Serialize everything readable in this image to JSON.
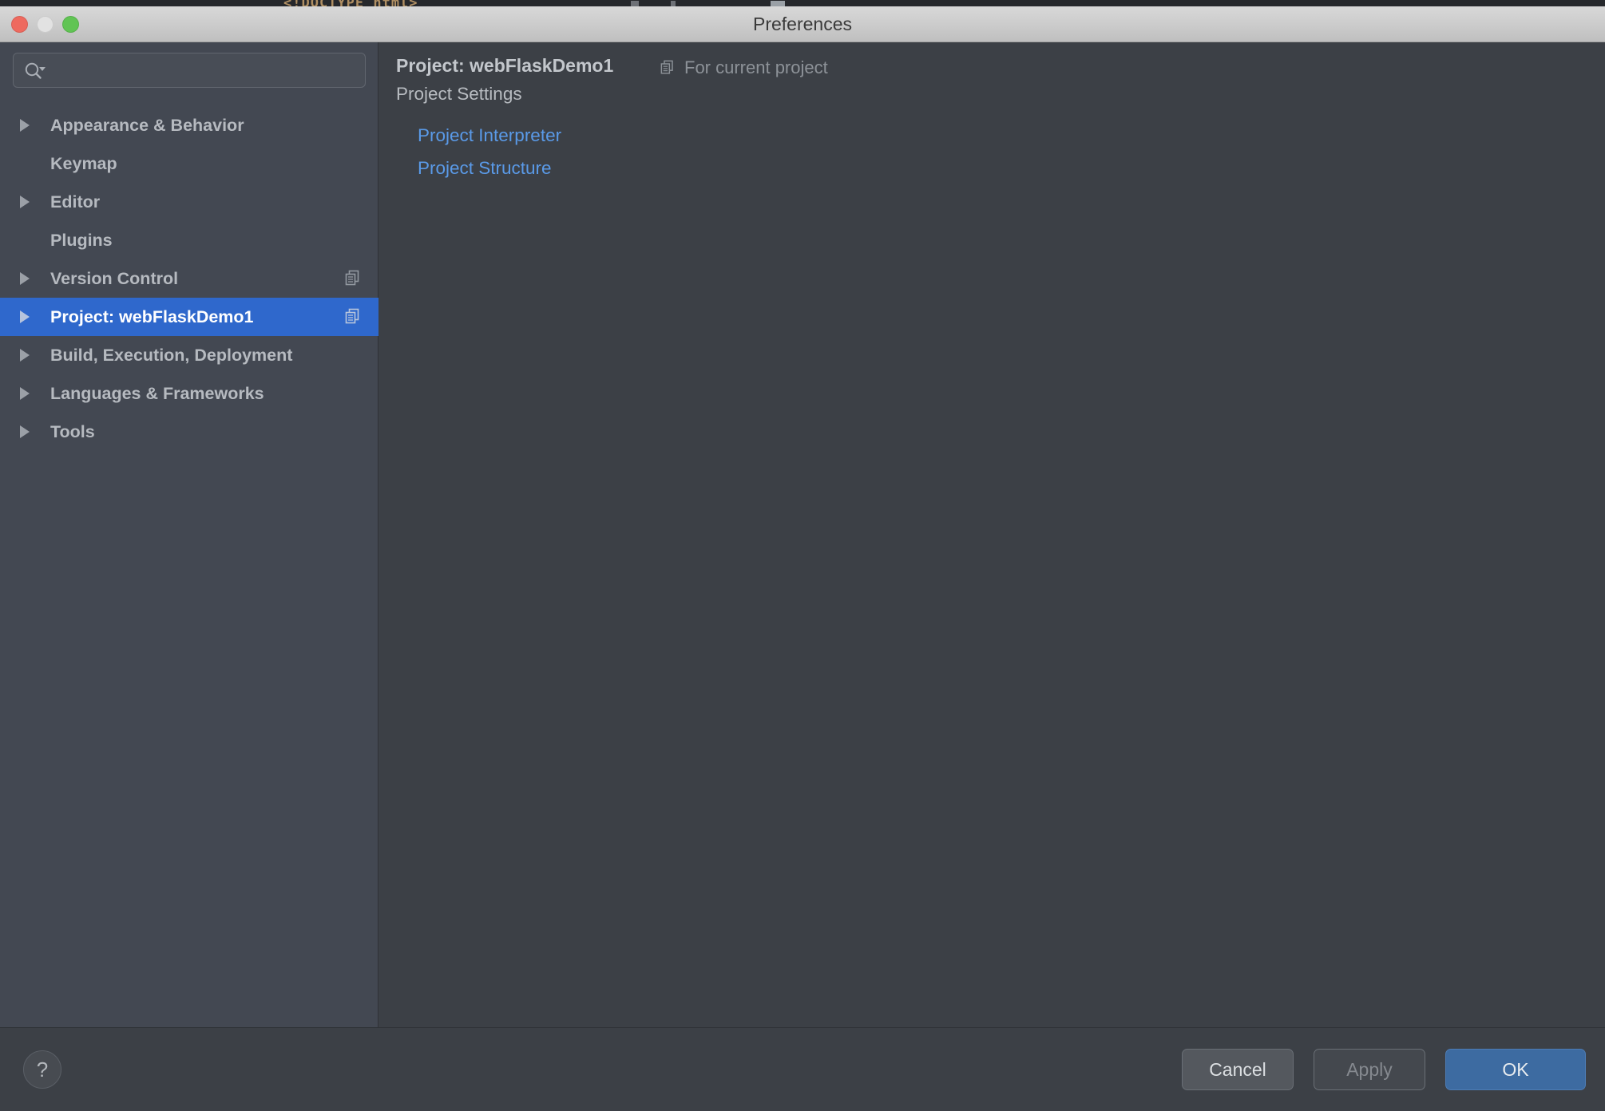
{
  "window": {
    "title": "Preferences",
    "traffic_lights": [
      "close-button",
      "minimize-button",
      "zoom-button"
    ],
    "backdrop_code": "<!DOCTYPE html>"
  },
  "search": {
    "value": "",
    "placeholder": "",
    "icon": "search-icon"
  },
  "sidebar": {
    "items": [
      {
        "label": "Appearance & Behavior",
        "expandable": true,
        "selected": false,
        "badge": ""
      },
      {
        "label": "Keymap",
        "expandable": false,
        "selected": false,
        "badge": ""
      },
      {
        "label": "Editor",
        "expandable": true,
        "selected": false,
        "badge": ""
      },
      {
        "label": "Plugins",
        "expandable": false,
        "selected": false,
        "badge": ""
      },
      {
        "label": "Version Control",
        "expandable": true,
        "selected": false,
        "badge": "copy-icon"
      },
      {
        "label": "Project: webFlaskDemo1",
        "expandable": true,
        "selected": true,
        "badge": "copy-icon"
      },
      {
        "label": "Build, Execution, Deployment",
        "expandable": true,
        "selected": false,
        "badge": ""
      },
      {
        "label": "Languages & Frameworks",
        "expandable": true,
        "selected": false,
        "badge": ""
      },
      {
        "label": "Tools",
        "expandable": true,
        "selected": false,
        "badge": ""
      }
    ]
  },
  "main": {
    "panel_title": "Project: webFlaskDemo1",
    "scope_icon": "copy-icon",
    "scope_label": "For current project",
    "section_heading": "Project Settings",
    "links": [
      {
        "label": "Project Interpreter"
      },
      {
        "label": "Project Structure"
      }
    ]
  },
  "footer": {
    "help_label": "?",
    "cancel_label": "Cancel",
    "apply_label": "Apply",
    "ok_label": "OK"
  },
  "colors": {
    "sidebar_bg": "#434852",
    "panel_bg": "#3c4046",
    "selection_blue": "#2f68cc",
    "link_blue": "#5a9ae8",
    "ok_button_blue": "#3d6ba1",
    "titlebar_gray": "#cbcbcb",
    "close_red": "#ee6a5f",
    "minimize_gray": "#e2e2e2",
    "zoom_green": "#61c454"
  }
}
